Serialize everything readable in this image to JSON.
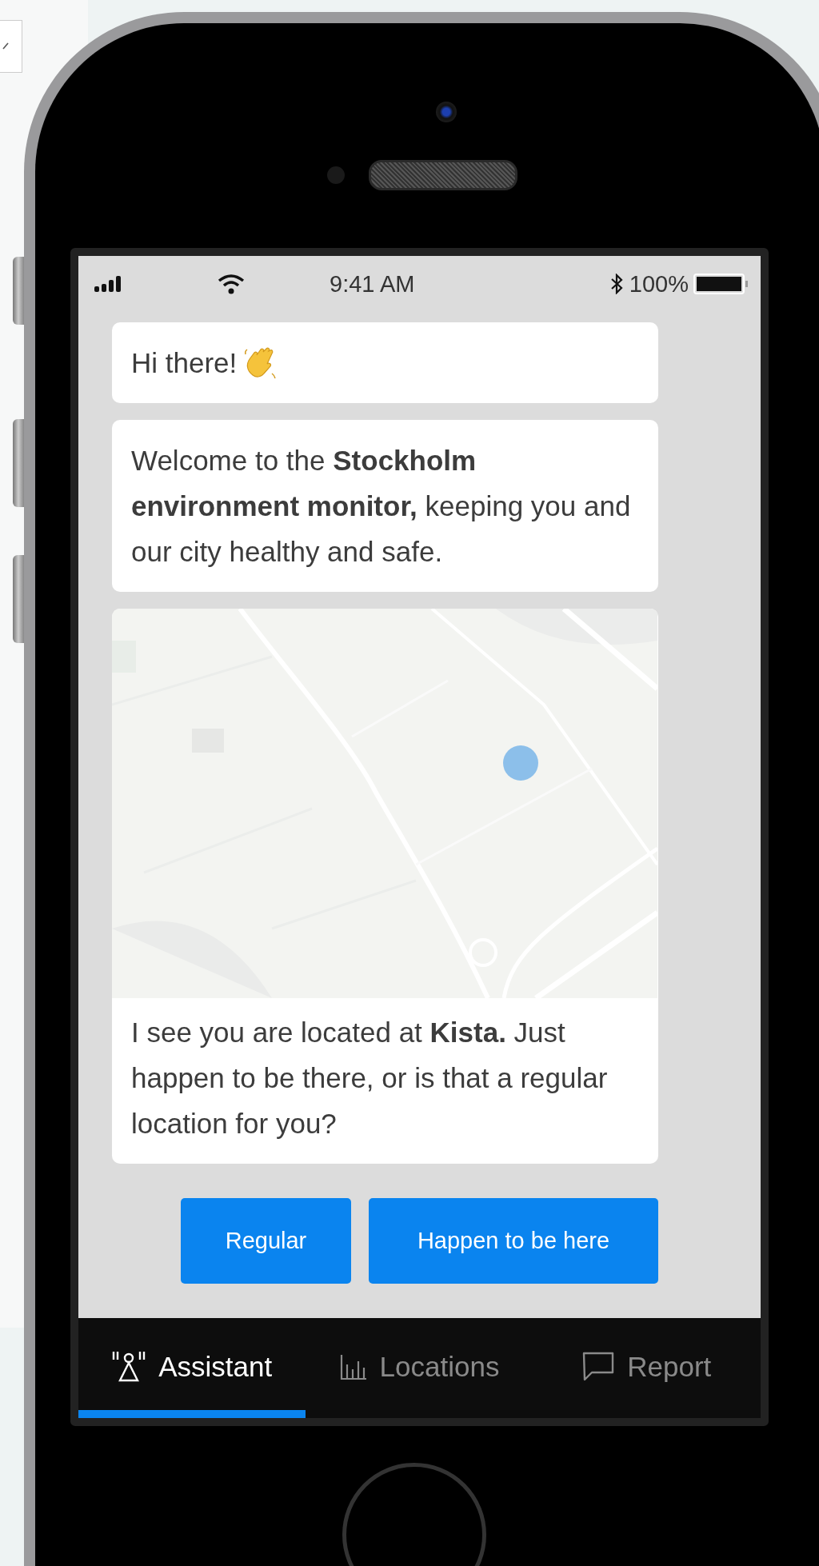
{
  "status_bar": {
    "time": "9:41 AM",
    "battery": "100%"
  },
  "messages": [
    {
      "kind": "greeting",
      "text": "Hi there!"
    },
    {
      "kind": "text",
      "text": "Welcome to the **Stockholm environment monitor,** keeping you and our city healthy and safe."
    },
    {
      "kind": "map",
      "text": "I see you are located at **Kista.** Just happen to be there, or is that a regular location for you?"
    }
  ],
  "quick_replies": [
    {
      "label": "Regular"
    },
    {
      "label": "Happen to be here"
    }
  ],
  "tabs": [
    {
      "kind": "assistant",
      "label": "Assistant",
      "selected": true
    },
    {
      "kind": "locations",
      "label": "Locations",
      "selected": false
    },
    {
      "kind": "report",
      "label": "Report",
      "selected": false
    }
  ]
}
